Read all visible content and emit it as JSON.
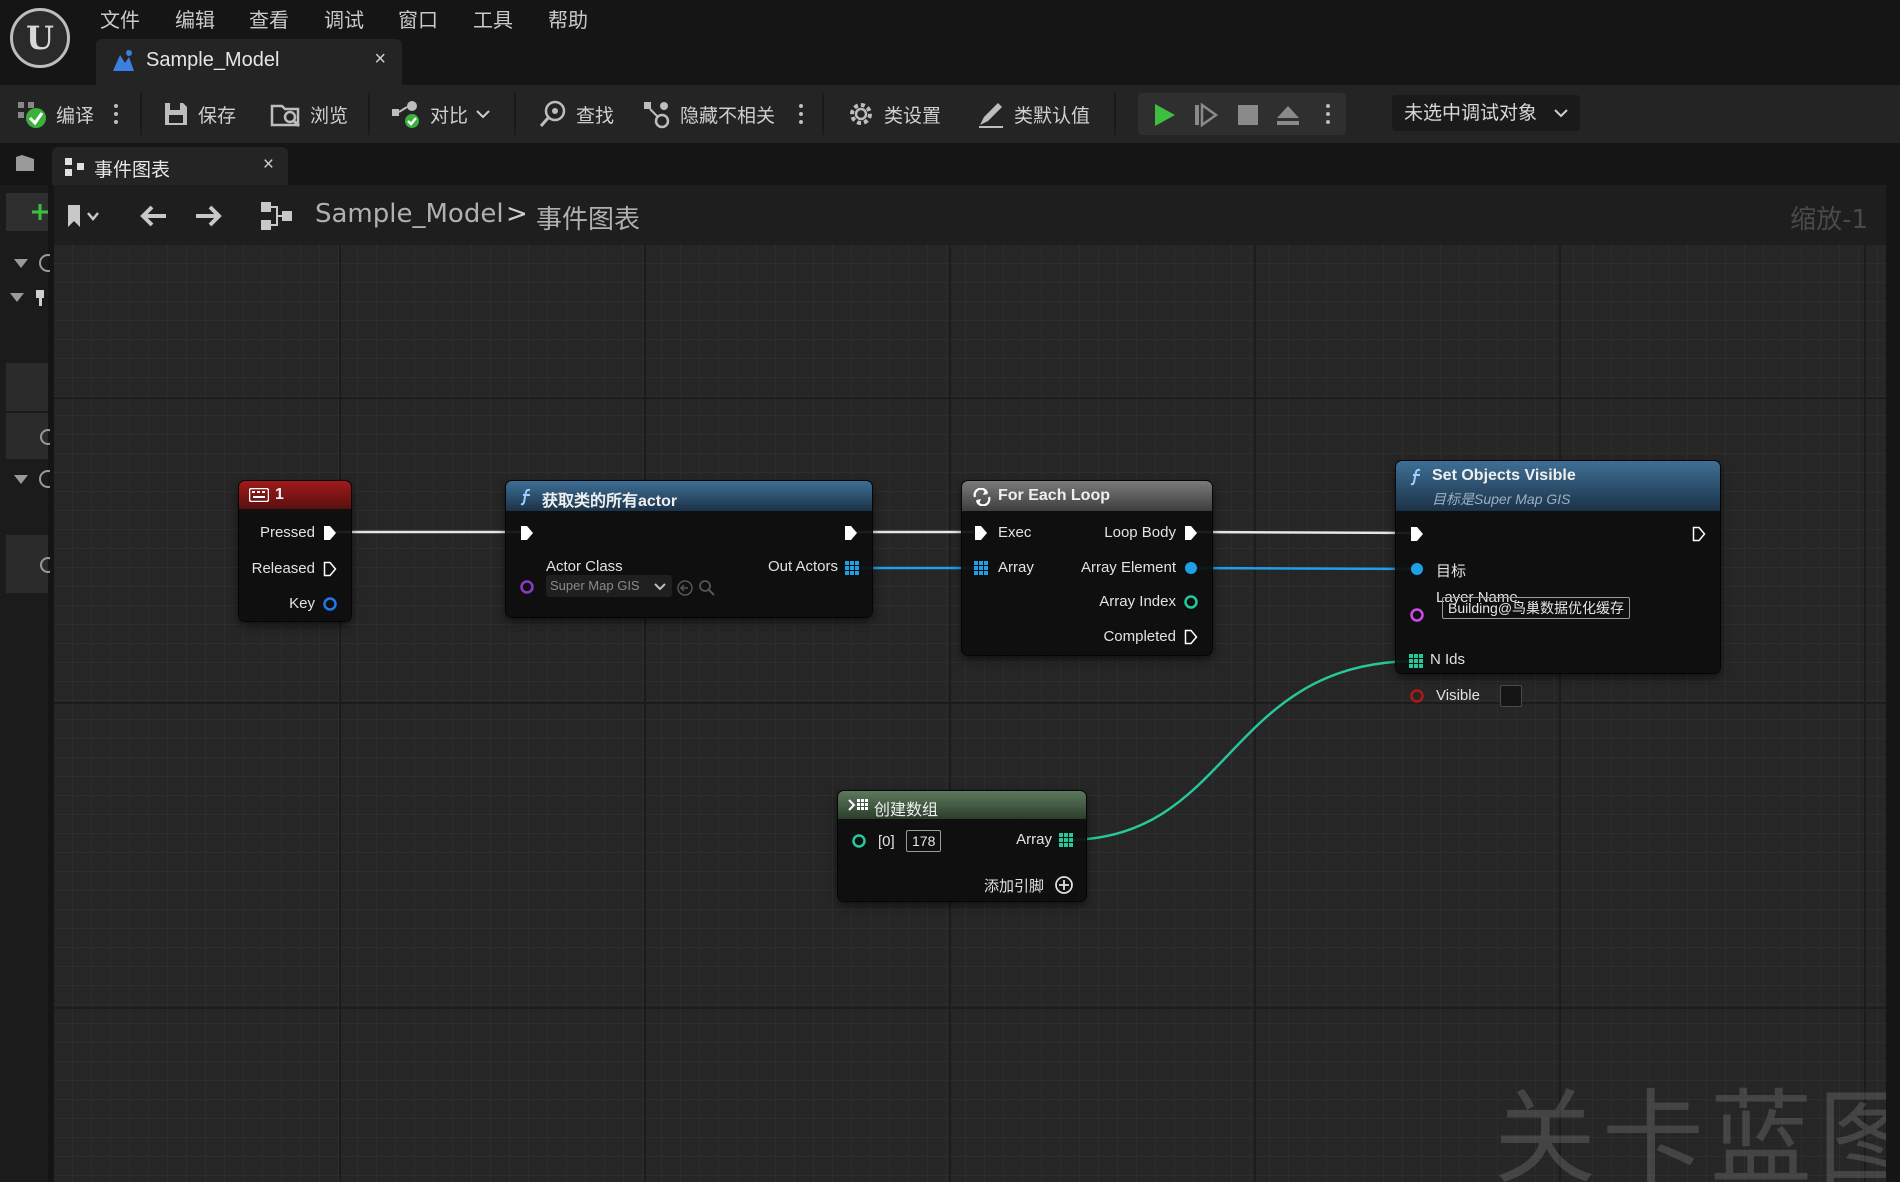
{
  "menu": {
    "items": [
      "文件",
      "编辑",
      "查看",
      "调试",
      "窗口",
      "工具",
      "帮助"
    ]
  },
  "doc_tab": {
    "label": "Sample_Model",
    "close": "×"
  },
  "toolbar": {
    "compile": "编译",
    "save": "保存",
    "browse": "浏览",
    "diff": "对比",
    "find": "查找",
    "hide_unrelated": "隐藏不相关",
    "class_settings": "类设置",
    "class_defaults": "类默认值",
    "debug_target": "未选中调试对象"
  },
  "graph_tab": {
    "label": "事件图表",
    "close": "×"
  },
  "breadcrumb": {
    "root": "Sample_Model",
    "separator": ">",
    "current": "事件图表",
    "zoom": "缩放-1"
  },
  "nodes": {
    "key_event": {
      "title": "1",
      "pins": {
        "pressed": "Pressed",
        "released": "Released",
        "key": "Key"
      }
    },
    "get_all_actors": {
      "title": "获取类的所有actor",
      "actor_class_label": "Actor Class",
      "actor_class_value": "Super Map GIS",
      "out_actors": "Out Actors"
    },
    "for_each": {
      "title": "For Each Loop",
      "exec": "Exec",
      "array": "Array",
      "loop_body": "Loop Body",
      "array_element": "Array Element",
      "array_index": "Array Index",
      "completed": "Completed"
    },
    "set_visible": {
      "title": "Set Objects Visible",
      "subtitle": "目标是Super Map GIS",
      "target": "目标",
      "layer_name_label": "Layer Name",
      "layer_name_value": "Building@鸟巢数据优化缓存",
      "n_ids": "N Ids",
      "visible": "Visible"
    },
    "make_array": {
      "title": "创建数组",
      "index_label": "[0]",
      "index_value": "178",
      "array": "Array",
      "add_pin": "添加引脚"
    }
  },
  "colors": {
    "exec": "#ffffff",
    "object": "#1ea0e6",
    "int": "#26c89a",
    "bool": "#b01818",
    "class": "#8a3cc8",
    "string": "#d04aea"
  },
  "watermark": "关卡蓝图"
}
